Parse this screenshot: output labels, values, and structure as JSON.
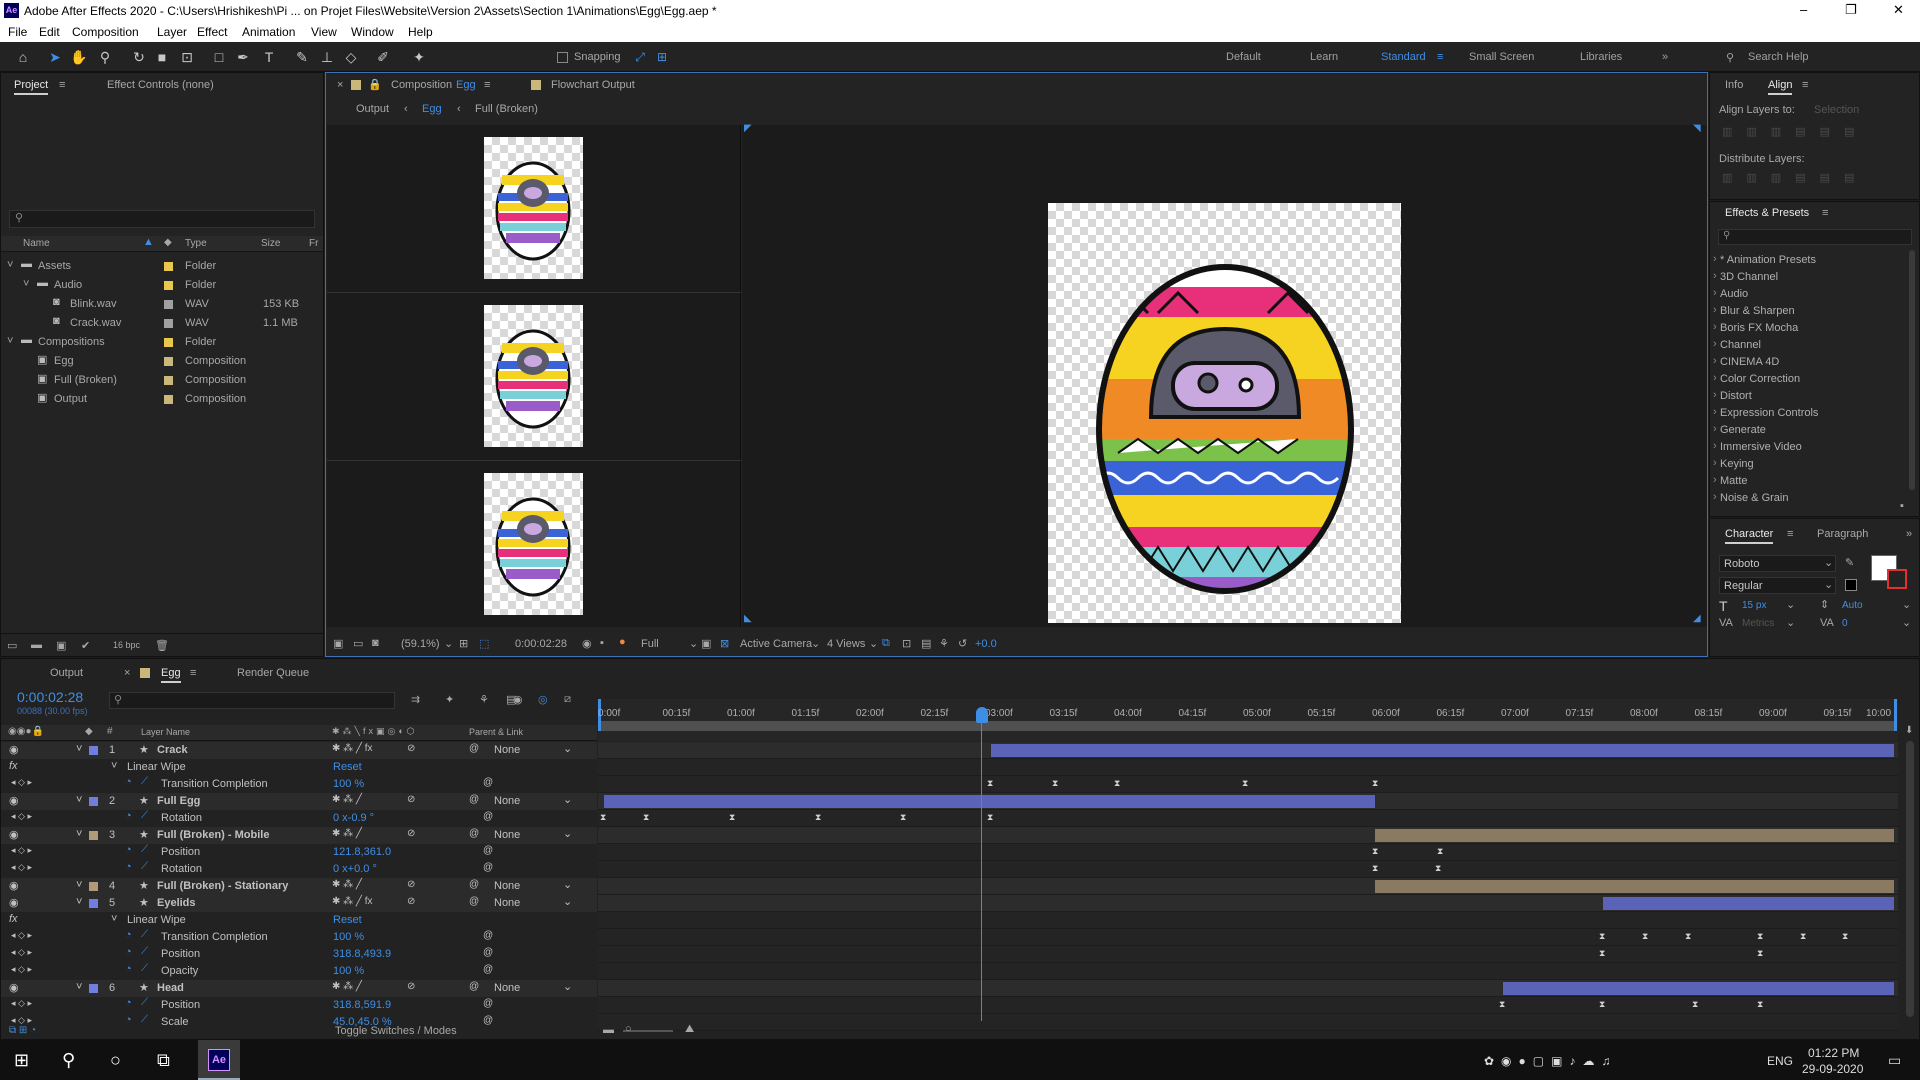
{
  "window": {
    "title": "Adobe After Effects 2020 - C:\\Users\\Hrishikesh\\Pi ... on Projet Files\\Website\\Version 2\\Assets\\Section 1\\Animations\\Egg\\Egg.aep *",
    "minimize": "–",
    "maximize": "❐",
    "close": "✕"
  },
  "menu": [
    "File",
    "Edit",
    "Composition",
    "Layer",
    "Effect",
    "Animation",
    "View",
    "Window",
    "Help"
  ],
  "toolbar": {
    "snapping": "Snapping",
    "workspaces": [
      "Default",
      "Learn",
      "Standard",
      "Small Screen",
      "Libraries"
    ],
    "active_workspace": "Standard",
    "search_placeholder": "Search Help"
  },
  "project": {
    "tab_project": "Project",
    "tab_effect_controls": "Effect Controls (none)",
    "columns": {
      "name": "Name",
      "type": "Type",
      "size": "Size",
      "fr": "Fr"
    },
    "items": [
      {
        "indent": 0,
        "expand": "˅",
        "name": "Assets",
        "color": "#e8c84a",
        "type": "Folder",
        "size": ""
      },
      {
        "indent": 1,
        "expand": "˅",
        "name": "Audio",
        "color": "#e8c84a",
        "type": "Folder",
        "size": ""
      },
      {
        "indent": 2,
        "expand": "",
        "name": "Blink.wav",
        "color": "#a0a0a0",
        "type": "WAV",
        "size": "153 KB"
      },
      {
        "indent": 2,
        "expand": "",
        "name": "Crack.wav",
        "color": "#a0a0a0",
        "type": "WAV",
        "size": "1.1 MB"
      },
      {
        "indent": 0,
        "expand": "˅",
        "name": "Compositions",
        "color": "#e8c84a",
        "type": "Folder",
        "size": ""
      },
      {
        "indent": 1,
        "expand": "",
        "name": "Egg",
        "color": "#c9b87a",
        "type": "Composition",
        "size": ""
      },
      {
        "indent": 1,
        "expand": "",
        "name": "Full (Broken)",
        "color": "#c9b87a",
        "type": "Composition",
        "size": ""
      },
      {
        "indent": 1,
        "expand": "",
        "name": "Output",
        "color": "#c9b87a",
        "type": "Composition",
        "size": ""
      }
    ],
    "bpc": "16 bpc"
  },
  "composition": {
    "tab_comp": "Composition",
    "tab_comp_name": "Egg",
    "tab_flowchart": "Flowchart Output",
    "breadcrumbs": [
      "Output",
      "Egg",
      "Full (Broken)"
    ],
    "zoom": "(59.1%)",
    "timecode": "0:00:02:28",
    "resolution": "Full",
    "camera": "Active Camera",
    "views": "4 Views",
    "exposure": "+0.0"
  },
  "right": {
    "tab_info": "Info",
    "tab_align": "Align",
    "align_layers_to_label": "Align Layers to:",
    "align_layers_to_value": "Selection",
    "distribute_label": "Distribute Layers:",
    "effects_title": "Effects & Presets",
    "effects": [
      "* Animation Presets",
      "3D Channel",
      "Audio",
      "Blur & Sharpen",
      "Boris FX Mocha",
      "Channel",
      "CINEMA 4D",
      "Color Correction",
      "Distort",
      "Expression Controls",
      "Generate",
      "Immersive Video",
      "Keying",
      "Matte",
      "Noise & Grain"
    ],
    "tab_character": "Character",
    "tab_paragraph": "Paragraph",
    "font": "Roboto",
    "style": "Regular",
    "size": "15 px",
    "leading": "Auto",
    "metrics": "Metrics",
    "tracking": "0"
  },
  "timeline": {
    "tabs": [
      "Output",
      "Egg",
      "Render Queue"
    ],
    "timecode": "0:00:02:28",
    "fps": "00088 (30.00 fps)",
    "col_layer_name": "Layer Name",
    "col_parent": "Parent & Link",
    "ruler": [
      "0:00f",
      "00:15f",
      "01:00f",
      "01:15f",
      "02:00f",
      "02:15f",
      "03:00f",
      "03:15f",
      "04:00f",
      "04:15f",
      "05:00f",
      "05:15f",
      "06:00f",
      "06:15f",
      "07:00f",
      "07:15f",
      "08:00f",
      "08:15f",
      "09:00f",
      "09:15f",
      "10:00"
    ],
    "toggle": "Toggle Switches / Modes",
    "rows": [
      {
        "kind": "layer",
        "num": "1",
        "name": "Crack",
        "color": "#6f7ee0",
        "parent": "None",
        "fx": true
      },
      {
        "kind": "effect",
        "name": "Linear Wipe",
        "value": "Reset"
      },
      {
        "kind": "prop",
        "name": "Transition Completion",
        "value": "100 %"
      },
      {
        "kind": "layer",
        "num": "2",
        "name": "Full Egg",
        "color": "#6f7ee0",
        "parent": "None",
        "fx": false
      },
      {
        "kind": "prop",
        "name": "Rotation",
        "value": "0 x-0.9 °"
      },
      {
        "kind": "layer",
        "num": "3",
        "name": "Full (Broken) - Mobile",
        "color": "#b09a78",
        "parent": "None",
        "fx": false
      },
      {
        "kind": "prop",
        "name": "Position",
        "value": "121.8,361.0"
      },
      {
        "kind": "prop",
        "name": "Rotation",
        "value": "0 x+0.0 °"
      },
      {
        "kind": "layer",
        "num": "4",
        "name": "Full (Broken) - Stationary",
        "color": "#b09a78",
        "parent": "None",
        "fx": false
      },
      {
        "kind": "layer",
        "num": "5",
        "name": "Eyelids",
        "color": "#6f7ee0",
        "parent": "None",
        "fx": true
      },
      {
        "kind": "effect",
        "name": "Linear Wipe",
        "value": "Reset"
      },
      {
        "kind": "prop",
        "name": "Transition Completion",
        "value": "100 %"
      },
      {
        "kind": "prop",
        "name": "Position",
        "value": "318.8,493.9"
      },
      {
        "kind": "prop",
        "name": "Opacity",
        "value": "100 %"
      },
      {
        "kind": "layer",
        "num": "6",
        "name": "Head",
        "color": "#6f7ee0",
        "parent": "None",
        "fx": false
      },
      {
        "kind": "prop",
        "name": "Position",
        "value": "318.8,591.9"
      },
      {
        "kind": "prop",
        "name": "Scale",
        "value": "45.0,45.0 %"
      }
    ]
  },
  "taskbar": {
    "lang": "ENG",
    "time": "01:22 PM",
    "date": "29-09-2020"
  }
}
